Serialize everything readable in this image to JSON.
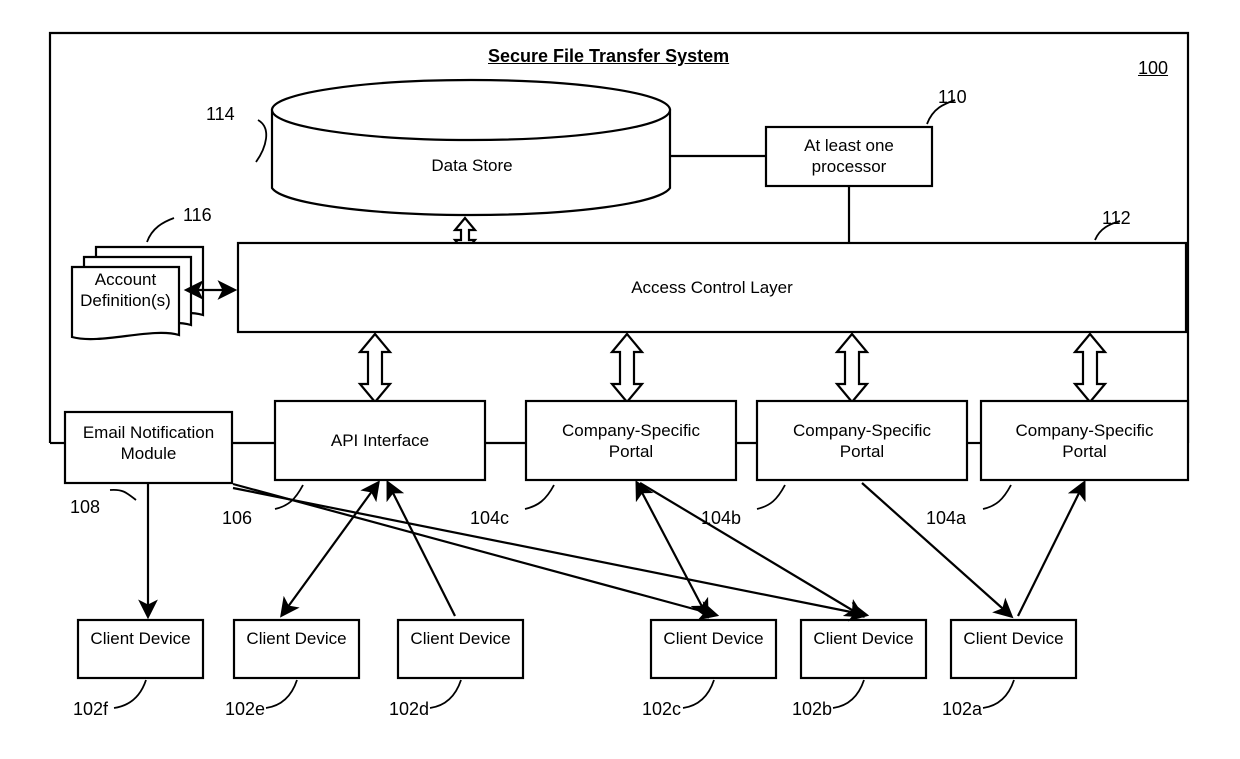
{
  "figure": {
    "title": "Secure File Transfer System",
    "figure_number": "100"
  },
  "nodes": {
    "data_store": {
      "label": "Data Store",
      "ref": "114"
    },
    "processor": {
      "label": "At least one\nprocessor",
      "ref": "110"
    },
    "account_definitions": {
      "label": "Account\nDefinition(s)",
      "ref": "116"
    },
    "access_control_layer": {
      "label": "Access Control Layer",
      "ref": "112"
    },
    "email_module": {
      "label": "Email Notification\nModule",
      "ref": "108"
    },
    "api_interface": {
      "label": "API Interface",
      "ref": "106"
    },
    "portal_c": {
      "label": "Company-Specific\nPortal",
      "ref": "104c"
    },
    "portal_b": {
      "label": "Company-Specific\nPortal",
      "ref": "104b"
    },
    "portal_a": {
      "label": "Company-Specific\nPortal",
      "ref": "104a"
    },
    "client_f": {
      "label": "Client Device",
      "ref": "102f"
    },
    "client_e": {
      "label": "Client Device",
      "ref": "102e"
    },
    "client_d": {
      "label": "Client Device",
      "ref": "102d"
    },
    "client_c": {
      "label": "Client Device",
      "ref": "102c"
    },
    "client_b": {
      "label": "Client Device",
      "ref": "102b"
    },
    "client_a": {
      "label": "Client Device",
      "ref": "102a"
    }
  },
  "colors": {
    "stroke": "#000000",
    "fill": "#ffffff",
    "background": "#ffffff"
  }
}
